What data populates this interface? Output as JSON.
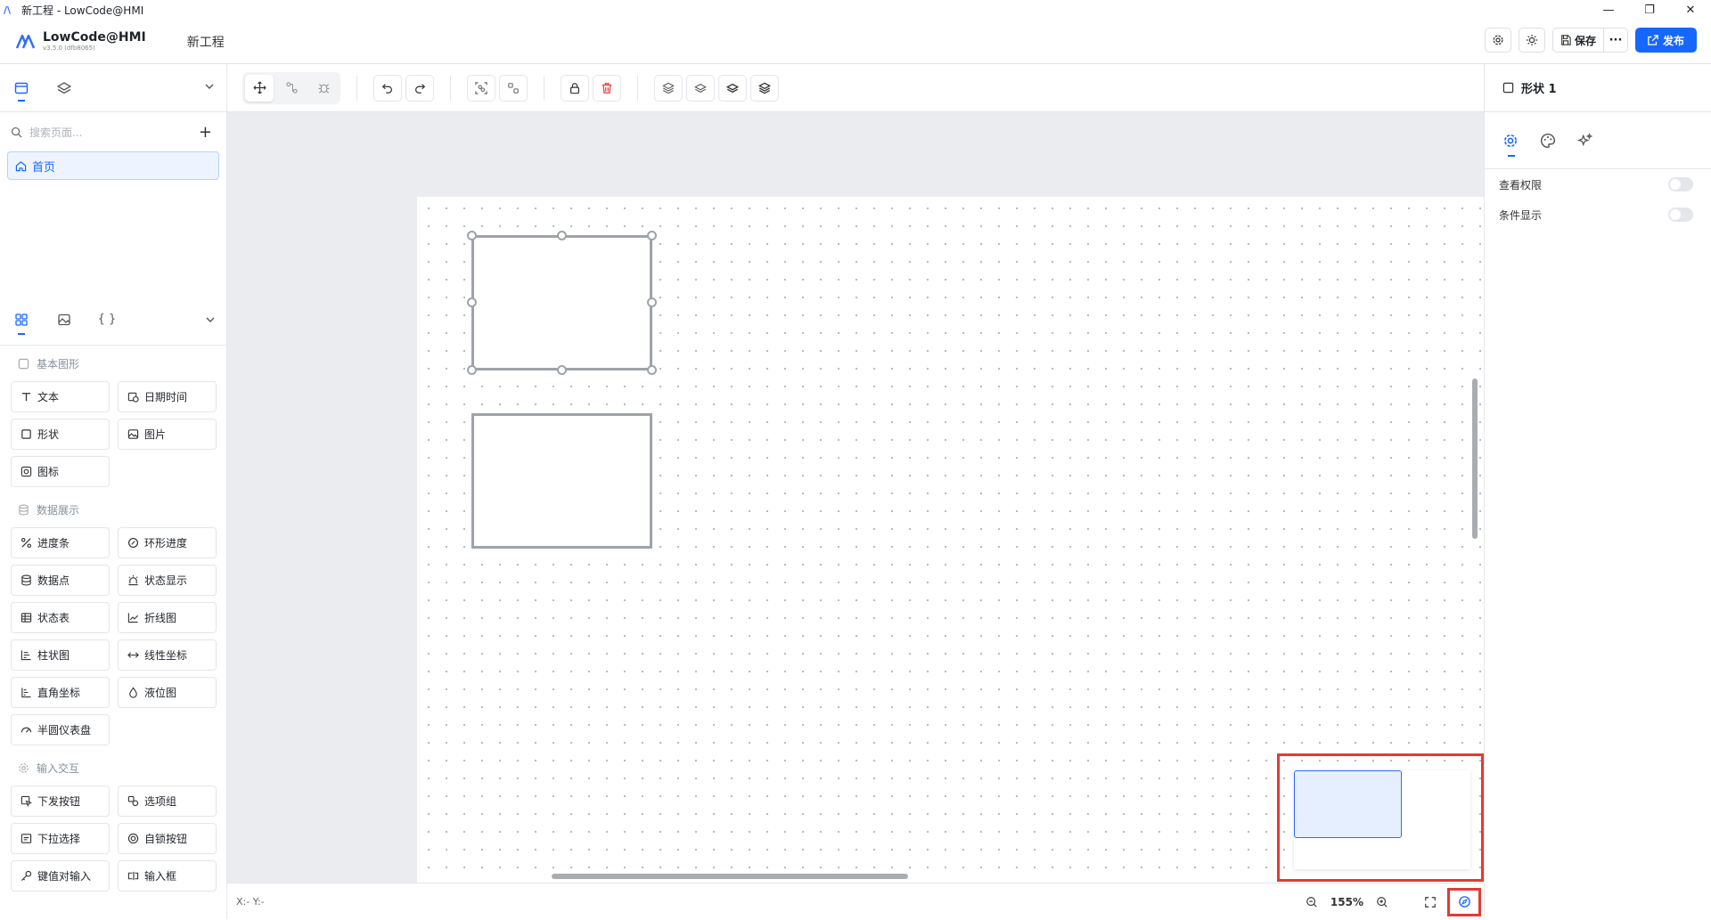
{
  "window": {
    "title": "新工程 - LowCode@HMI",
    "controls": [
      "—",
      "❐",
      "✕"
    ]
  },
  "header": {
    "app_name": "LowCode@HMI",
    "version": "v3.5.0 (dfb8065)",
    "project_name": "新工程",
    "save_label": "保存",
    "more_label": "···",
    "publish_label": "发布",
    "accent": "#1667ff"
  },
  "pages": {
    "search_placeholder": "搜索页面...",
    "items": [
      {
        "label": "首页",
        "icon": "home-icon"
      }
    ]
  },
  "components": {
    "sections": [
      {
        "title": "基本图形",
        "items": [
          {
            "label": "文本",
            "icon": "text-icon"
          },
          {
            "label": "日期时间",
            "icon": "calendar-clock-icon"
          },
          {
            "label": "形状",
            "icon": "square-icon"
          },
          {
            "label": "图片",
            "icon": "image-icon"
          },
          {
            "label": "图标",
            "icon": "icon-icon"
          }
        ]
      },
      {
        "title": "数据展示",
        "items": [
          {
            "label": "进度条",
            "icon": "percent-icon"
          },
          {
            "label": "环形进度",
            "icon": "ring-progress-icon"
          },
          {
            "label": "数据点",
            "icon": "database-icon"
          },
          {
            "label": "状态显示",
            "icon": "siren-icon"
          },
          {
            "label": "状态表",
            "icon": "table-icon"
          },
          {
            "label": "折线图",
            "icon": "line-chart-icon"
          },
          {
            "label": "柱状图",
            "icon": "bar-chart-icon"
          },
          {
            "label": "线性坐标",
            "icon": "arrows-horizontal-icon"
          },
          {
            "label": "直角坐标",
            "icon": "axis-icon"
          },
          {
            "label": "液位图",
            "icon": "liquid-level-icon"
          },
          {
            "label": "半圆仪表盘",
            "icon": "gauge-icon"
          }
        ]
      },
      {
        "title": "输入交互",
        "items": [
          {
            "label": "下发按钮",
            "icon": "pointer-icon"
          },
          {
            "label": "选项组",
            "icon": "option-group-icon"
          },
          {
            "label": "下拉选择",
            "icon": "select-icon"
          },
          {
            "label": "自锁按钮",
            "icon": "lock-button-icon"
          },
          {
            "label": "键值对输入",
            "icon": "key-icon"
          },
          {
            "label": "输入框",
            "icon": "input-icon"
          }
        ]
      }
    ]
  },
  "canvas": {
    "background": "#ebecef",
    "artboard": "#ffffff",
    "shape_border": "#9ea3aa"
  },
  "statusbar": {
    "coords": "X:- Y:-",
    "zoom": "155%"
  },
  "inspector": {
    "title": "形状 1",
    "properties": [
      {
        "label": "查看权限",
        "on": false
      },
      {
        "label": "条件显示",
        "on": false
      }
    ]
  }
}
